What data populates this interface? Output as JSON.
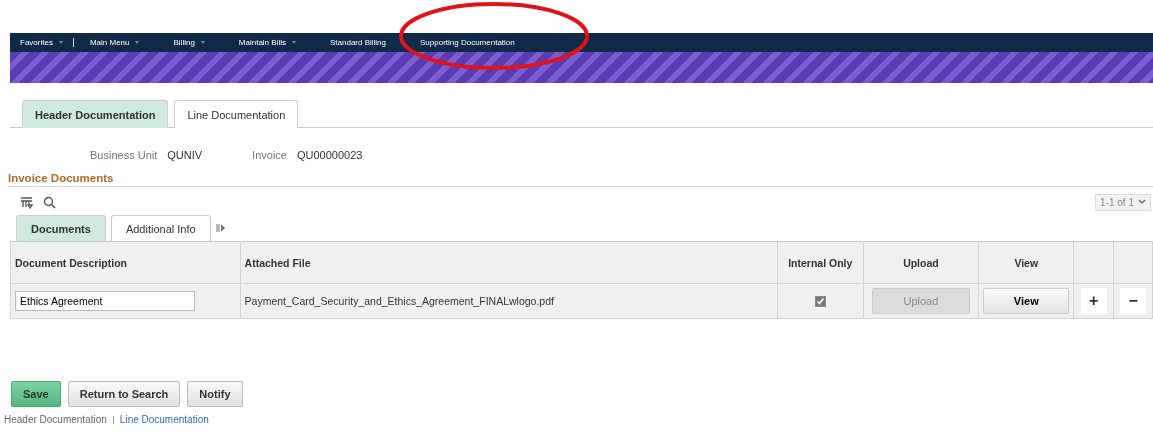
{
  "nav": [
    {
      "label": "Favorites",
      "dropdown": true
    },
    {
      "label": "Main Menu",
      "dropdown": true
    },
    {
      "label": "Billing",
      "dropdown": true
    },
    {
      "label": "Maintain Bills",
      "dropdown": true
    },
    {
      "label": "Standard Billing",
      "dropdown": false
    },
    {
      "label": "Supporting Documentation",
      "dropdown": false
    }
  ],
  "page_tabs": [
    {
      "label": "Header Documentation",
      "selected": true
    },
    {
      "label": "Line Documentation",
      "selected": false
    }
  ],
  "fields": [
    {
      "label": "Business Unit",
      "value": "QUNIV"
    },
    {
      "label": "Invoice",
      "value": "QU00000023"
    }
  ],
  "section_title": "Invoice Documents",
  "pagination": "1-1 of 1",
  "grid_tabs": [
    {
      "label": "Documents",
      "selected": true
    },
    {
      "label": "Additional Info",
      "selected": false
    }
  ],
  "table": {
    "columns": [
      "Document Description",
      "Attached File",
      "Internal Only",
      "Upload",
      "View"
    ],
    "rows": [
      {
        "description": "Ethics Agreement",
        "file": "Payment_Card_Security_and_Ethics_Agreement_FINALwlogo.pdf",
        "internal_only": true,
        "upload": "Upload",
        "upload_disabled": true,
        "view": "View",
        "add": "+",
        "remove": "−"
      }
    ]
  },
  "buttons": [
    {
      "label": "Save",
      "kind": "primary"
    },
    {
      "label": "Return to Search",
      "kind": "secondary"
    },
    {
      "label": "Notify",
      "kind": "secondary"
    }
  ],
  "footer_links": [
    {
      "label": "Header Documentation",
      "selected": true
    },
    {
      "label": "Line Documentation",
      "selected": false
    }
  ]
}
